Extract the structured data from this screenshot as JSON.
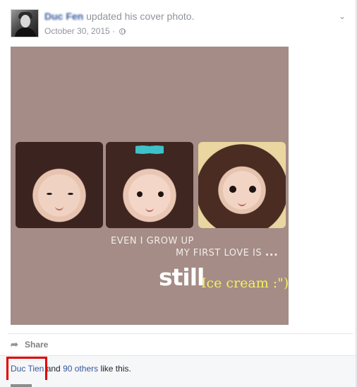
{
  "post": {
    "author": "Duc Fen",
    "action": "updated his cover photo.",
    "date": "October 30, 2015",
    "date_separator": "·",
    "privacy_icon": "globe-icon",
    "menu_icon": "chevron-down-icon"
  },
  "photo": {
    "line1": "EVEN I GROW UP",
    "line2_prefix": "MY FIRST LOVE IS",
    "line2_suffix": "...",
    "line3_bold": "still",
    "line3_rest": "Ice cream :\")",
    "colors": {
      "background": "#a58c86",
      "accent_text": "#f4f062"
    }
  },
  "actions": {
    "share_label": "Share",
    "share_icon": "share-arrow-icon"
  },
  "likes": {
    "liker": "Duc Tien",
    "connector": "and",
    "others": "90 others",
    "suffix": "like this."
  },
  "colors": {
    "link": "#365899",
    "highlight": "#e00000"
  }
}
